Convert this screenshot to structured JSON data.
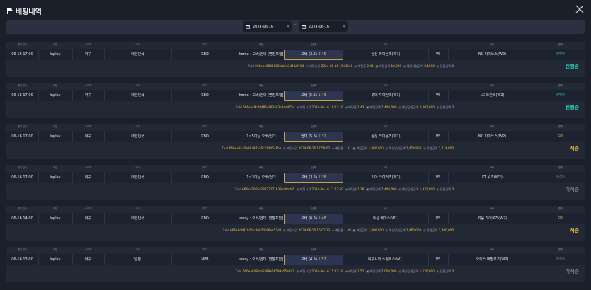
{
  "title": "베팅내역",
  "filter": {
    "date_from": "2024-06-16",
    "date_to": "2024-06-16",
    "separator": "~"
  },
  "headers": [
    "경기일시",
    "구분",
    "스포츠",
    "국가",
    "리그",
    "배팅",
    "선택",
    "W1",
    "",
    "W2",
    "결과"
  ],
  "labels": {
    "txid": "TxId",
    "bet_time": "배팅시간",
    "odds": "배팅율",
    "amount": "배팅금액",
    "expected": "예상당첨금액",
    "winnings": "당첨금액",
    "vs": "VS"
  },
  "colors": {
    "live": "#29d3c0",
    "win": "#f0c040",
    "lost": "#7c8190",
    "odds": "#f0c040"
  },
  "bets": [
    {
      "time": "06-16 17:00",
      "type": "Inplay",
      "sport": "야구",
      "country": "대한민국",
      "league": "KBO",
      "market": "home : 오버/언더 [연장포함]",
      "pick": "오버 (3.5)",
      "pick_odds": "2.45",
      "w1": "삼성 라이온즈(W1)",
      "w2": "NC 다이노스(W2)",
      "status": "진행중",
      "status_kind": "live",
      "txid": "666ebe6045086fda5d3d43af104",
      "bet_time": "2024-06-16 19:28:48",
      "odds": "2.45",
      "amount": "10,000",
      "expected": "24,500",
      "winnings": "0",
      "result": "진행중"
    },
    {
      "time": "06-16 17:00",
      "type": "Inplay",
      "sport": "야구",
      "country": "대한민국",
      "league": "KBO",
      "market": "home : 오버/언더 [연장포함]",
      "pick": "오버 (5.5)",
      "pick_odds": "1.43",
      "w1": "롯데 자이언츠(W1)",
      "w2": "LG 트윈스(W2)",
      "status": "진행중",
      "status_kind": "live",
      "txid": "666ebc9c08485c493a03b9ad475c",
      "bet_time": "2024-06-16 19:23:16",
      "odds": "1.43",
      "amount": "1,400,000",
      "expected": "2,002,000",
      "winnings": "0",
      "result": "진행중"
    },
    {
      "time": "06-16 17:00",
      "type": "Inplay",
      "sport": "야구",
      "country": "대한민국",
      "league": "KBO",
      "market": "1~5이닝 오버/언더",
      "pick": "언더 (5.5)",
      "pick_odds": "1.31",
      "w1": "삼성 라이온즈(W1)",
      "w2": "NC 다이노스(W2)",
      "status": "적중",
      "status_kind": "win",
      "txid": "666ea91a5e39a97a26c27d4641be",
      "bet_time": "2024-06-16 17:58:02",
      "odds": "1.31",
      "amount": "1,080,000",
      "expected": "1,414,800",
      "winnings": "1,414,800",
      "result": "적중"
    },
    {
      "time": "06-16 17:00",
      "type": "Inplay",
      "sport": "야구",
      "country": "대한민국",
      "league": "KBO",
      "market": "1~3이닝 오버/언더",
      "pick": "오버 (3.5)",
      "pick_odds": "1.38",
      "w1": "기아 타이거즈(W1)",
      "w2": "KT 위즈(W2)",
      "status": "미적중",
      "status_kind": "lost",
      "txid": "666ea2065d23872171639bcbbda6",
      "bet_time": "2024-06-16 17:27:50",
      "odds": "1.38",
      "amount": "1,400,000",
      "expected": "1,932,000",
      "winnings": "0",
      "result": "미적중"
    },
    {
      "time": "06-16 14:00",
      "type": "Inplay",
      "sport": "야구",
      "country": "대한민국",
      "league": "KBO",
      "market": "away : 오버/언더 [연장포함]",
      "pick": "오버 (6.5)",
      "pick_odds": "1.48",
      "w1": "두산 베어스(W1)",
      "w2": "키움 히어로즈(W2)",
      "status": "적중",
      "status_kind": "win",
      "txid": "666a8db9102fac8697dc86ea52d8",
      "bet_time": "2024-06-16 16:01:13",
      "odds": "1.48",
      "amount": "1,000,000",
      "expected": "1,480,000",
      "winnings": "1,480,000",
      "result": "적중"
    },
    {
      "time": "06-16 13:00",
      "type": "Inplay",
      "sport": "야구",
      "country": "일본",
      "league": "NPB",
      "market": "away : 오버/언더 [연장포함]",
      "pick": "오버 (4.5)",
      "pick_odds": "1.52",
      "w1": "히구시마 스퀄로스(W1)",
      "w2": "오릭스 버팔로즈(W2)",
      "status": "미적중",
      "status_kind": "lost",
      "txid": "666ea849fdd5589e66599a55afbf7",
      "bet_time": "2024-06-16 15:22:19",
      "odds": "1.52",
      "amount": "1,000,000",
      "expected": "1,520,000",
      "winnings": "0",
      "result": "미적중"
    }
  ]
}
